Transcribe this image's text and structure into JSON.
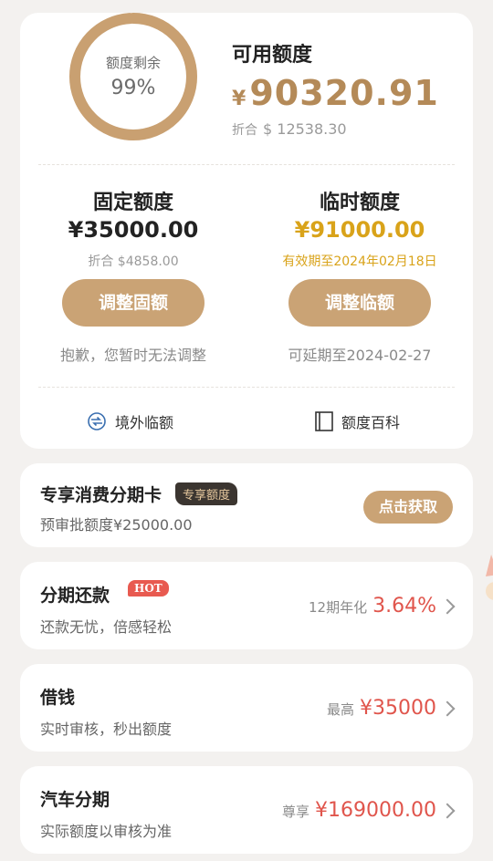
{
  "summary": {
    "gauge_label": "额度剩余",
    "gauge_percent_text": "99%",
    "gauge_fraction": 0.99,
    "available_title": "可用额度",
    "available_currency": "¥",
    "available_amount": "90320.91",
    "converted_label": "折合",
    "converted_value": "$ 12538.30"
  },
  "fixed": {
    "title": "固定额度",
    "amount": "¥35000.00",
    "sub": "折合 $4858.00",
    "button": "调整固额",
    "note": "抱歉，您暂时无法调整"
  },
  "temporary": {
    "title": "临时额度",
    "amount": "¥91000.00",
    "sub": "有效期至2024年02月18日",
    "button": "调整临额",
    "note": "可延期至2024-02-27"
  },
  "links": {
    "overseas": "境外临额",
    "encyclopedia": "额度百科"
  },
  "installment_card": {
    "title": "专享消费分期卡",
    "badge": "专享额度",
    "sub": "预审批额度¥25000.00",
    "button": "点击获取"
  },
  "repay": {
    "title": "分期还款",
    "badge": "HOT",
    "sub": "还款无忧，倍感轻松",
    "pre": "12期年化",
    "value": "3.64%"
  },
  "borrow": {
    "title": "借钱",
    "sub": "实时审核，秒出额度",
    "pre": "最高",
    "value": "¥35000"
  },
  "car": {
    "title": "汽车分期",
    "sub": "实际额度以审核为准",
    "pre": "尊享",
    "value": "¥169000.00"
  },
  "colors": {
    "gold": "#caa375",
    "gold_text": "#b48a58",
    "accent_yellow": "#d9a31a",
    "red": "#e0554c"
  }
}
